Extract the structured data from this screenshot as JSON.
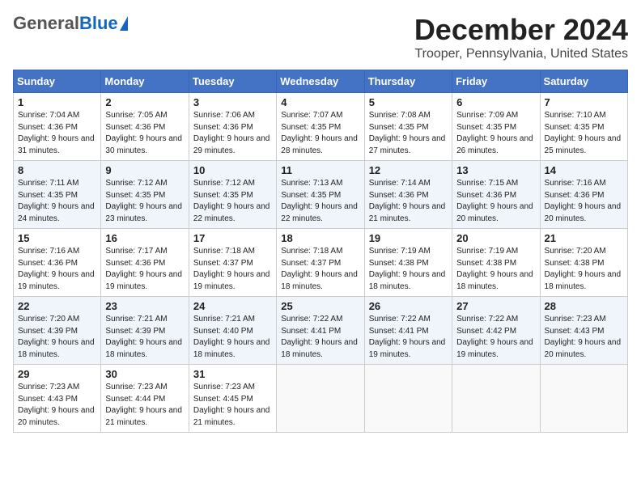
{
  "header": {
    "logo_general": "General",
    "logo_blue": "Blue",
    "title": "December 2024",
    "subtitle": "Trooper, Pennsylvania, United States"
  },
  "days_of_week": [
    "Sunday",
    "Monday",
    "Tuesday",
    "Wednesday",
    "Thursday",
    "Friday",
    "Saturday"
  ],
  "weeks": [
    [
      {
        "day": "1",
        "sunrise": "7:04 AM",
        "sunset": "4:36 PM",
        "daylight": "9 hours and 31 minutes."
      },
      {
        "day": "2",
        "sunrise": "7:05 AM",
        "sunset": "4:36 PM",
        "daylight": "9 hours and 30 minutes."
      },
      {
        "day": "3",
        "sunrise": "7:06 AM",
        "sunset": "4:36 PM",
        "daylight": "9 hours and 29 minutes."
      },
      {
        "day": "4",
        "sunrise": "7:07 AM",
        "sunset": "4:35 PM",
        "daylight": "9 hours and 28 minutes."
      },
      {
        "day": "5",
        "sunrise": "7:08 AM",
        "sunset": "4:35 PM",
        "daylight": "9 hours and 27 minutes."
      },
      {
        "day": "6",
        "sunrise": "7:09 AM",
        "sunset": "4:35 PM",
        "daylight": "9 hours and 26 minutes."
      },
      {
        "day": "7",
        "sunrise": "7:10 AM",
        "sunset": "4:35 PM",
        "daylight": "9 hours and 25 minutes."
      }
    ],
    [
      {
        "day": "8",
        "sunrise": "7:11 AM",
        "sunset": "4:35 PM",
        "daylight": "9 hours and 24 minutes."
      },
      {
        "day": "9",
        "sunrise": "7:12 AM",
        "sunset": "4:35 PM",
        "daylight": "9 hours and 23 minutes."
      },
      {
        "day": "10",
        "sunrise": "7:12 AM",
        "sunset": "4:35 PM",
        "daylight": "9 hours and 22 minutes."
      },
      {
        "day": "11",
        "sunrise": "7:13 AM",
        "sunset": "4:35 PM",
        "daylight": "9 hours and 22 minutes."
      },
      {
        "day": "12",
        "sunrise": "7:14 AM",
        "sunset": "4:36 PM",
        "daylight": "9 hours and 21 minutes."
      },
      {
        "day": "13",
        "sunrise": "7:15 AM",
        "sunset": "4:36 PM",
        "daylight": "9 hours and 20 minutes."
      },
      {
        "day": "14",
        "sunrise": "7:16 AM",
        "sunset": "4:36 PM",
        "daylight": "9 hours and 20 minutes."
      }
    ],
    [
      {
        "day": "15",
        "sunrise": "7:16 AM",
        "sunset": "4:36 PM",
        "daylight": "9 hours and 19 minutes."
      },
      {
        "day": "16",
        "sunrise": "7:17 AM",
        "sunset": "4:36 PM",
        "daylight": "9 hours and 19 minutes."
      },
      {
        "day": "17",
        "sunrise": "7:18 AM",
        "sunset": "4:37 PM",
        "daylight": "9 hours and 19 minutes."
      },
      {
        "day": "18",
        "sunrise": "7:18 AM",
        "sunset": "4:37 PM",
        "daylight": "9 hours and 18 minutes."
      },
      {
        "day": "19",
        "sunrise": "7:19 AM",
        "sunset": "4:38 PM",
        "daylight": "9 hours and 18 minutes."
      },
      {
        "day": "20",
        "sunrise": "7:19 AM",
        "sunset": "4:38 PM",
        "daylight": "9 hours and 18 minutes."
      },
      {
        "day": "21",
        "sunrise": "7:20 AM",
        "sunset": "4:38 PM",
        "daylight": "9 hours and 18 minutes."
      }
    ],
    [
      {
        "day": "22",
        "sunrise": "7:20 AM",
        "sunset": "4:39 PM",
        "daylight": "9 hours and 18 minutes."
      },
      {
        "day": "23",
        "sunrise": "7:21 AM",
        "sunset": "4:39 PM",
        "daylight": "9 hours and 18 minutes."
      },
      {
        "day": "24",
        "sunrise": "7:21 AM",
        "sunset": "4:40 PM",
        "daylight": "9 hours and 18 minutes."
      },
      {
        "day": "25",
        "sunrise": "7:22 AM",
        "sunset": "4:41 PM",
        "daylight": "9 hours and 18 minutes."
      },
      {
        "day": "26",
        "sunrise": "7:22 AM",
        "sunset": "4:41 PM",
        "daylight": "9 hours and 19 minutes."
      },
      {
        "day": "27",
        "sunrise": "7:22 AM",
        "sunset": "4:42 PM",
        "daylight": "9 hours and 19 minutes."
      },
      {
        "day": "28",
        "sunrise": "7:23 AM",
        "sunset": "4:43 PM",
        "daylight": "9 hours and 20 minutes."
      }
    ],
    [
      {
        "day": "29",
        "sunrise": "7:23 AM",
        "sunset": "4:43 PM",
        "daylight": "9 hours and 20 minutes."
      },
      {
        "day": "30",
        "sunrise": "7:23 AM",
        "sunset": "4:44 PM",
        "daylight": "9 hours and 21 minutes."
      },
      {
        "day": "31",
        "sunrise": "7:23 AM",
        "sunset": "4:45 PM",
        "daylight": "9 hours and 21 minutes."
      },
      null,
      null,
      null,
      null
    ]
  ],
  "labels": {
    "sunrise": "Sunrise:",
    "sunset": "Sunset:",
    "daylight": "Daylight:"
  }
}
